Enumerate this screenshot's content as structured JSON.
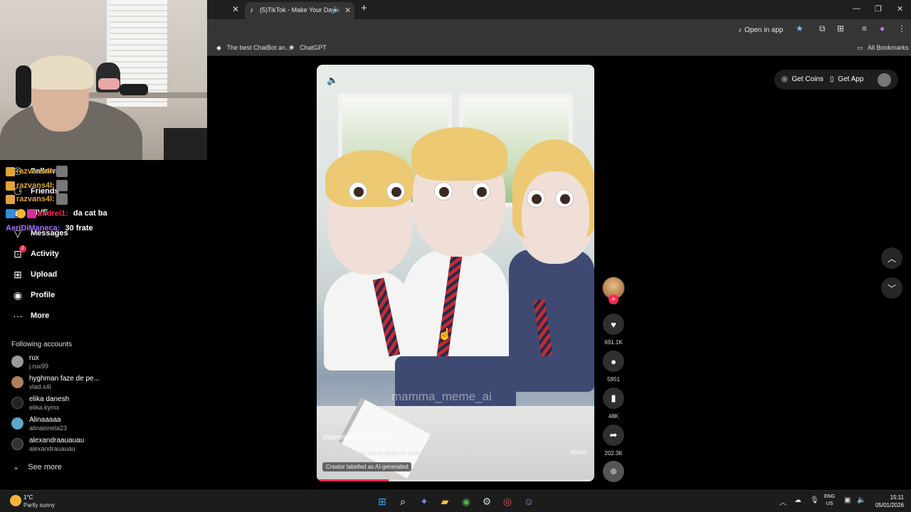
{
  "browser": {
    "active_tab_title": "(5)TikTok - Make Your Day",
    "open_in_app_label": "Open in app",
    "bookmarks": [
      {
        "label": "The best ChatBot an..."
      },
      {
        "label": "ChatGPT"
      }
    ],
    "all_bookmarks_label": "All Bookmarks"
  },
  "chat_overlay": {
    "lines": [
      {
        "user": "razvans4l:",
        "message": ""
      },
      {
        "user": "razvans4l:",
        "message": ""
      },
      {
        "user": "razvans4l:",
        "message": ""
      },
      {
        "user": "andrei1:",
        "message": "da cat ba"
      },
      {
        "user": "AeriDiManeca:",
        "message": "30 frate"
      }
    ]
  },
  "sidebar": {
    "items": [
      {
        "label": "Following",
        "icon": "users-icon"
      },
      {
        "label": "Friends",
        "icon": "friends-icon"
      },
      {
        "label": "LIVE",
        "icon": "live-icon"
      },
      {
        "label": "Messages",
        "icon": "messages-icon"
      },
      {
        "label": "Activity",
        "icon": "activity-icon",
        "badge": "2"
      },
      {
        "label": "Upload",
        "icon": "upload-icon"
      },
      {
        "label": "Profile",
        "icon": "profile-icon"
      },
      {
        "label": "More",
        "icon": "more-icon"
      }
    ],
    "following_title": "Following accounts",
    "accounts": [
      {
        "name": "rux",
        "handle": "j.rux99"
      },
      {
        "name": "hyghman faze de pe...",
        "handle": "vlad.s4l"
      },
      {
        "name": "elika danesh",
        "handle": "elika.kymx"
      },
      {
        "name": "Alinaaaaa",
        "handle": "alinaionela23"
      },
      {
        "name": "alexandraauauau",
        "handle": "alexandrauauau"
      }
    ],
    "see_more_label": "See more"
  },
  "video": {
    "watermark": "mamma_meme_ai",
    "author": "mamma_meme_ai",
    "caption": "Tung tung tung sahur goes to school#italianbrainrot #tungtungtungsahur ...",
    "more_label": "more",
    "ai_label": "Creator labelled as AI-generated",
    "progress": 0.26
  },
  "actions": {
    "likes": "691.1K",
    "comments": "5951",
    "saves": "48K",
    "shares": "202.3K"
  },
  "top_right": {
    "get_coins_label": "Get Coins",
    "get_app_label": "Get App"
  },
  "taskbar": {
    "weather_temp": "1°C",
    "weather_desc": "Partly sunny",
    "lang_line1": "ENG",
    "lang_line2": "US",
    "time": "15:11",
    "date": "05/01/2026"
  },
  "colors": {
    "accent": "#fe2c55",
    "bg": "#000000",
    "chrome_bar": "#353535"
  }
}
